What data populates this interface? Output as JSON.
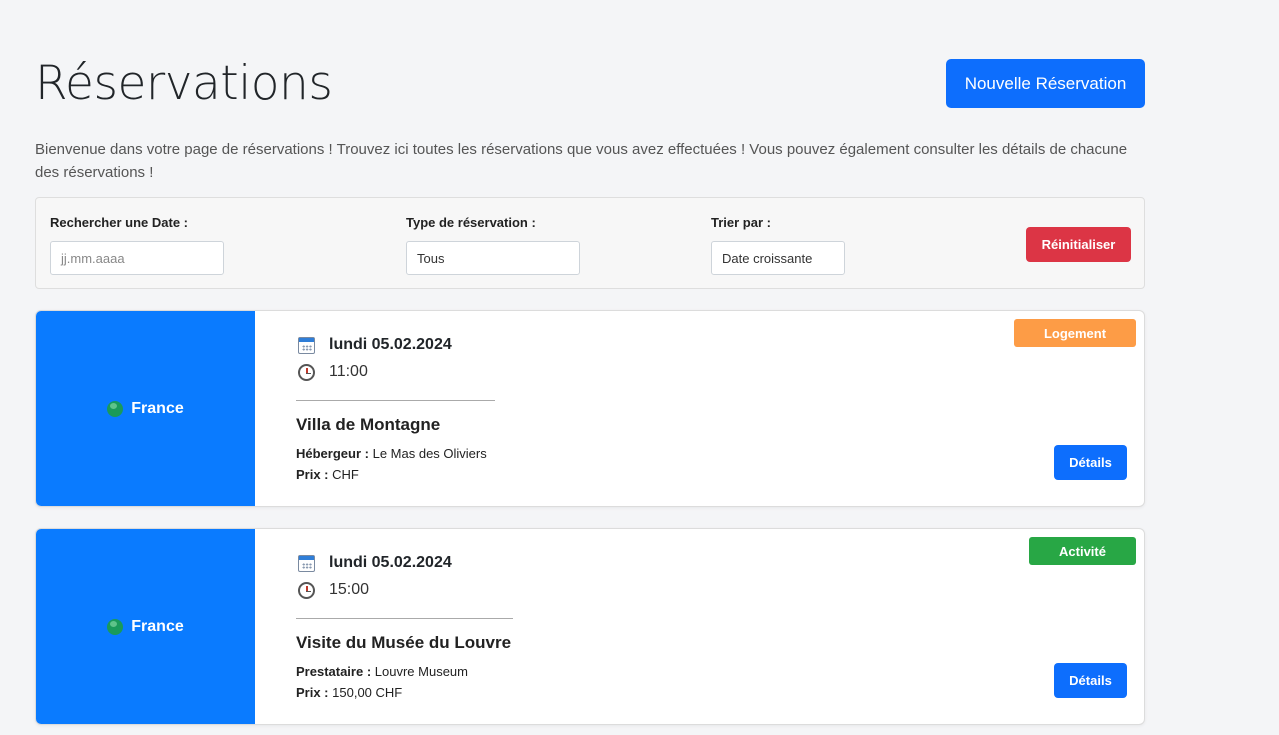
{
  "header": {
    "title": "Réservations",
    "new_button": "Nouvelle Réservation"
  },
  "intro": "Bienvenue dans votre page de réservations ! Trouvez ici toutes les réservations que vous avez effectuées ! Vous pouvez également consulter les détails de chacune des réservations !",
  "filters": {
    "date_label": "Rechercher une Date :",
    "date_placeholder": "jj.mm.aaaa",
    "type_label": "Type de réservation :",
    "type_value": "Tous",
    "sort_label": "Trier par :",
    "sort_value": "Date croissante",
    "reset_button": "Réinitialiser"
  },
  "reservations": [
    {
      "country": "France",
      "country_icon": "globe-icon",
      "date": "lundi 05.02.2024",
      "time": "11:00",
      "title": "Villa de Montagne",
      "provider_label": "Hébergeur :",
      "provider": "Le Mas des Oliviers",
      "price_label": "Prix :",
      "price": "CHF",
      "badge": "Logement",
      "badge_color": "#fd9c46",
      "details_button": "Détails"
    },
    {
      "country": "France",
      "country_icon": "globe-icon",
      "date": "lundi 05.02.2024",
      "time": "15:00",
      "title": "Visite du Musée du Louvre",
      "provider_label": "Prestataire :",
      "provider": "Louvre Museum",
      "price_label": "Prix :",
      "price": "150,00 CHF",
      "badge": "Activité",
      "badge_color": "#28a745",
      "details_button": "Détails"
    }
  ],
  "colors": {
    "primary": "#0d6efd",
    "card_side": "#0a7bff",
    "danger": "#dc3545"
  }
}
